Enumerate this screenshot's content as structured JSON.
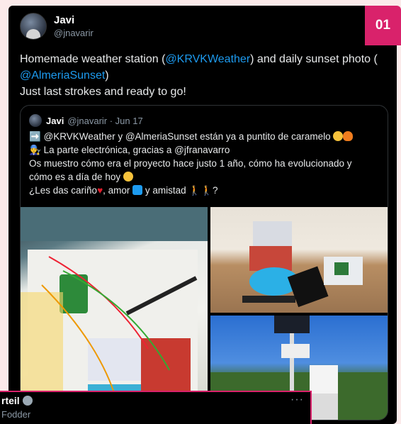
{
  "badge": "01",
  "author": {
    "name": "Javi",
    "handle": "@jnavarir"
  },
  "tweet": {
    "prefix": "Homemade weather station (",
    "mention1": "@KRVKWeather",
    "middle": ") and daily sunset photo (",
    "mention2": "@AlmeriaSunset",
    "close": ")",
    "line2": "Just last strokes and ready to go!"
  },
  "quote": {
    "name": "Javi",
    "meta": "@jnavarir · Jun 17",
    "lines": [
      "@KRVKWeather y @AlmeriaSunset están ya a puntito de caramelo",
      "La parte electrónica, gracias a @jfranavarro",
      "Os muestro cómo era el proyecto hace justo 1 año, cómo ha evolucionado y",
      "cómo es a día de hoy",
      "¿Les das cariño",
      ", amor",
      " y amistad",
      "?"
    ]
  },
  "reply": {
    "name": "rteil",
    "handle": "Fodder",
    "more": "···"
  },
  "colors": {
    "accent": "#d9226b",
    "link": "#1d9bf0",
    "background": "#000000"
  }
}
